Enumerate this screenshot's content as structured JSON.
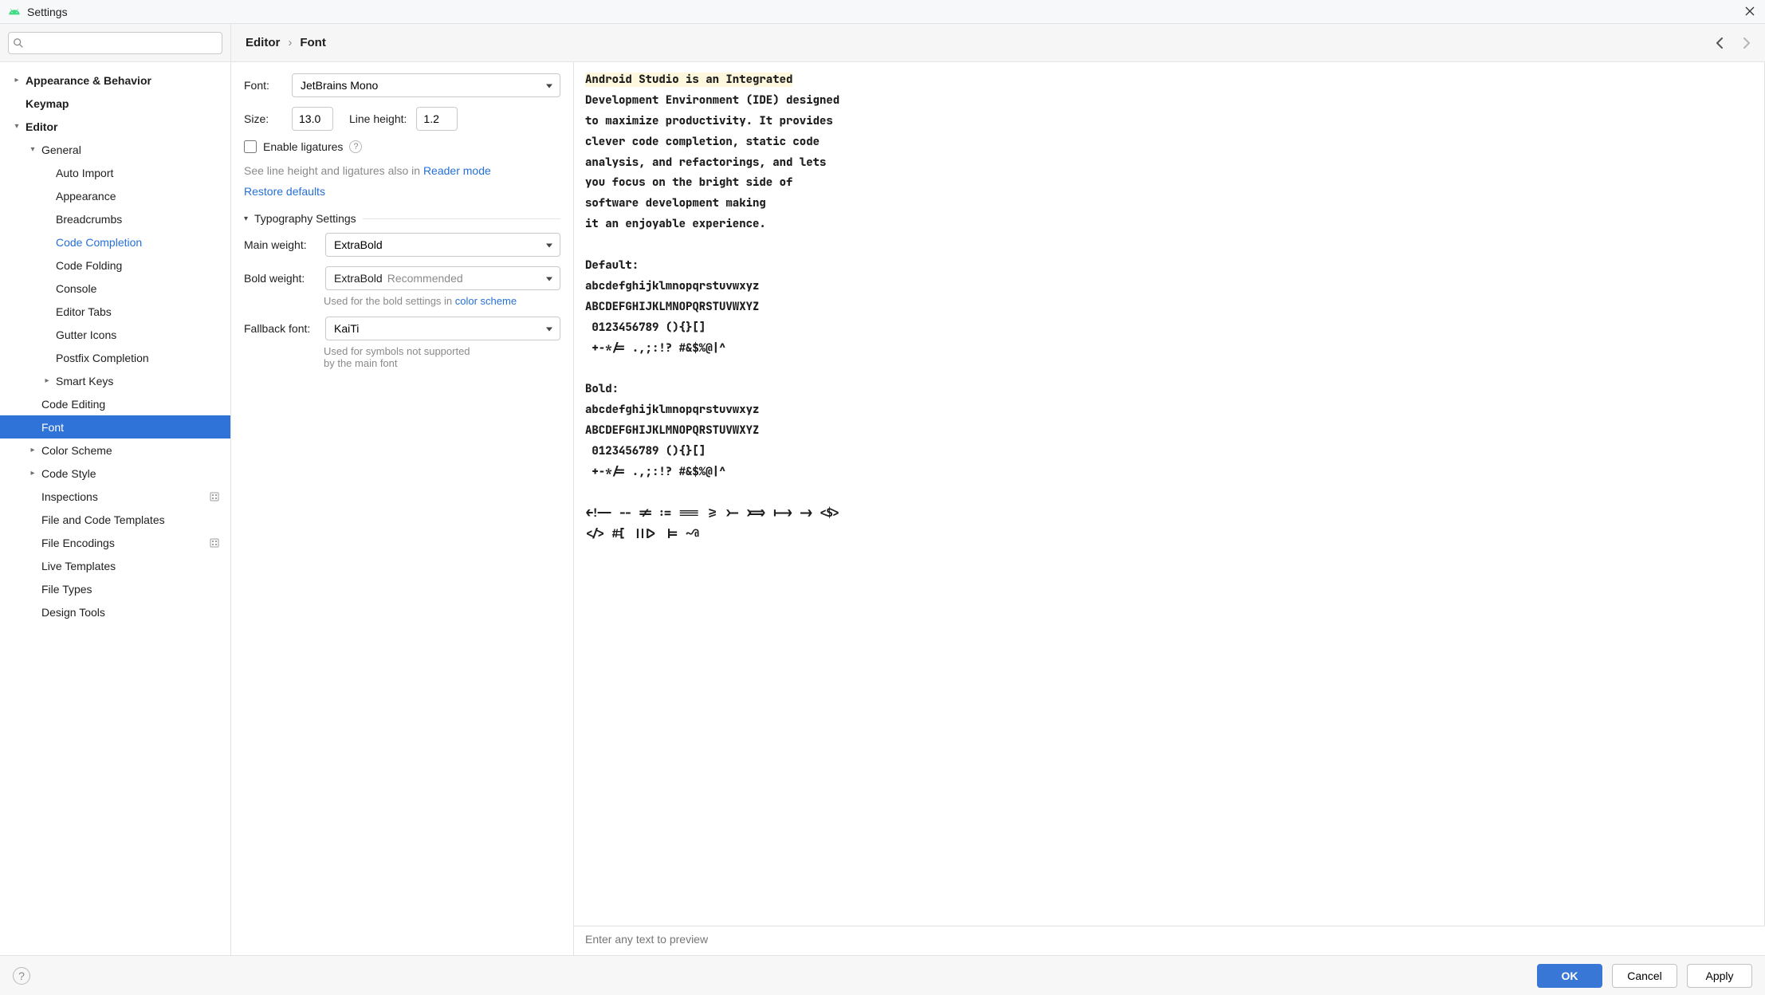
{
  "window": {
    "title": "Settings"
  },
  "breadcrumb": {
    "root": "Editor",
    "leaf": "Font"
  },
  "search": {
    "placeholder": ""
  },
  "tree": [
    {
      "label": "Appearance & Behavior",
      "level": 0,
      "bold": true,
      "expandable": true,
      "expanded": false
    },
    {
      "label": "Keymap",
      "level": 0,
      "bold": true
    },
    {
      "label": "Editor",
      "level": 0,
      "bold": true,
      "expandable": true,
      "expanded": true
    },
    {
      "label": "General",
      "level": 1,
      "expandable": true,
      "expanded": true
    },
    {
      "label": "Auto Import",
      "level": 2
    },
    {
      "label": "Appearance",
      "level": 2
    },
    {
      "label": "Breadcrumbs",
      "level": 2
    },
    {
      "label": "Code Completion",
      "level": 2,
      "active": true
    },
    {
      "label": "Code Folding",
      "level": 2
    },
    {
      "label": "Console",
      "level": 2
    },
    {
      "label": "Editor Tabs",
      "level": 2
    },
    {
      "label": "Gutter Icons",
      "level": 2
    },
    {
      "label": "Postfix Completion",
      "level": 2
    },
    {
      "label": "Smart Keys",
      "level": 2,
      "expandable": true,
      "expanded": false
    },
    {
      "label": "Code Editing",
      "level": 1
    },
    {
      "label": "Font",
      "level": 1,
      "selected": true
    },
    {
      "label": "Color Scheme",
      "level": 1,
      "expandable": true,
      "expanded": false
    },
    {
      "label": "Code Style",
      "level": 1,
      "expandable": true,
      "expanded": false
    },
    {
      "label": "Inspections",
      "level": 1,
      "badge": true
    },
    {
      "label": "File and Code Templates",
      "level": 1
    },
    {
      "label": "File Encodings",
      "level": 1,
      "badge": true
    },
    {
      "label": "Live Templates",
      "level": 1
    },
    {
      "label": "File Types",
      "level": 1
    },
    {
      "label": "Design Tools",
      "level": 1
    }
  ],
  "form": {
    "font_label": "Font:",
    "font_value": "JetBrains Mono",
    "size_label": "Size:",
    "size_value": "13.0",
    "lineheight_label": "Line height:",
    "lineheight_value": "1.2",
    "ligatures_label": "Enable ligatures",
    "reader_hint_pre": "See line height and ligatures also in ",
    "reader_hint_link": "Reader mode",
    "restore_link": "Restore defaults",
    "typography_header": "Typography Settings",
    "main_weight_label": "Main weight:",
    "main_weight_value": "ExtraBold",
    "bold_weight_label": "Bold weight:",
    "bold_weight_value": "ExtraBold",
    "bold_weight_hint": "Recommended",
    "bold_helper_pre": "Used for the bold settings in ",
    "bold_helper_link": "color scheme",
    "fallback_label": "Fallback font:",
    "fallback_value": "KaiTi",
    "fallback_helper": "Used for symbols not supported\nby the main font"
  },
  "preview": {
    "text": "Android Studio is an Integrated\nDevelopment Environment (IDE) designed\nto maximize productivity. It provides\nclever code completion, static code\nanalysis, and refactorings, and lets\nyou focus on the bright side of\nsoftware development making\nit an enjoyable experience.\n\nDefault:\nabcdefghijklmnopqrstuvwxyz\nABCDEFGHIJKLMNOPQRSTUVWXYZ\n 0123456789 (){}[]\n +-*/= .,;:!? #&$%@|^\n\nBold:\nabcdefghijklmnopqrstuvwxyz\nABCDEFGHIJKLMNOPQRSTUVWXYZ\n 0123456789 (){}[]\n +-*/= .,;:!? #&$%@|^\n\n<!-- -- != := === >= >- >=> |-> -> <$>\n</> #[ |||> |= ~@",
    "first_line_chars": 31,
    "input_placeholder": "Enter any text to preview"
  },
  "footer": {
    "ok": "OK",
    "cancel": "Cancel",
    "apply": "Apply"
  }
}
